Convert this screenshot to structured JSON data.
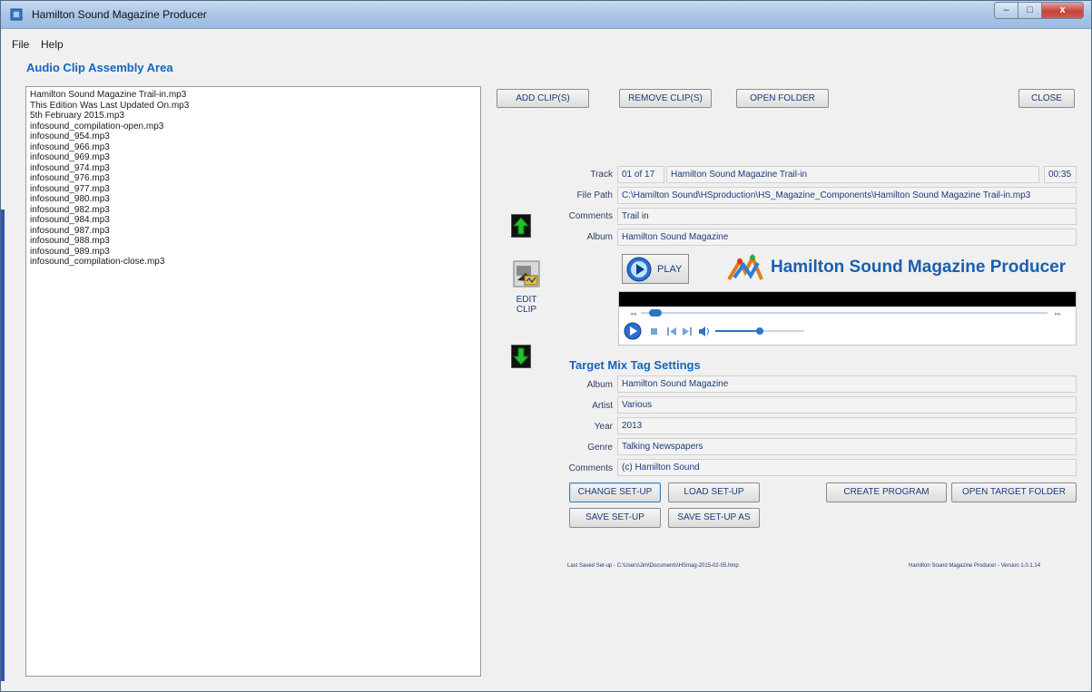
{
  "window": {
    "title": "Hamilton Sound Magazine Producer",
    "controls": [
      "–",
      "□",
      "x"
    ]
  },
  "menu": [
    "File",
    "Help"
  ],
  "assembly_area_title": "Audio Clip Assembly Area",
  "clips": [
    "Hamilton Sound Magazine Trail-in.mp3",
    "This Edition Was Last Updated On.mp3",
    "5th February 2015.mp3",
    "infosound_compilation-open.mp3",
    "infosound_954.mp3",
    "infosound_966.mp3",
    "infosound_969.mp3",
    "infosound_974.mp3",
    "infosound_976.mp3",
    "infosound_977.mp3",
    "infosound_980.mp3",
    "infosound_982.mp3",
    "infosound_984.mp3",
    "infosound_987.mp3",
    "infosound_988.mp3",
    "infosound_989.mp3",
    "infosound_compilation-close.mp3"
  ],
  "top_buttons": {
    "add": "ADD CLIP(S)",
    "remove": "REMOVE CLIP(S)",
    "open_folder": "OPEN FOLDER",
    "close": "CLOSE"
  },
  "edit_clip_label": "EDIT CLIP",
  "track_info": {
    "track_label": "Track",
    "track_number": "01 of 17",
    "track_name": "Hamilton Sound Magazine Trail-in",
    "duration": "00:35",
    "file_path_label": "File Path",
    "file_path": "C:\\Hamilton Sound\\HSproduction\\HS_Magazine_Components\\Hamilton Sound Magazine Trail-in.mp3",
    "comments_label": "Comments",
    "comments": "Trail in",
    "album_label": "Album",
    "album": "Hamilton Sound Magazine"
  },
  "play_label": "PLAY",
  "brand_title": "Hamilton Sound Magazine Producer",
  "player": {
    "seek_position": 0.02,
    "volume_level": 0.5
  },
  "target_mix": {
    "title": "Target Mix Tag Settings",
    "album_label": "Album",
    "album": "Hamilton Sound Magazine",
    "artist_label": "Artist",
    "artist": "Various",
    "year_label": "Year",
    "year": "2013",
    "genre_label": "Genre",
    "genre": "Talking Newspapers",
    "comments_label": "Comments",
    "comments": "(c) Hamilton Sound"
  },
  "setup_buttons": {
    "change": "CHANGE SET-UP",
    "load": "LOAD SET-UP",
    "save": "SAVE SET-UP",
    "save_as": "SAVE SET-UP AS",
    "create_program": "CREATE PROGRAM",
    "open_target_folder": "OPEN TARGET FOLDER"
  },
  "footer": {
    "last_saved": "Last Saved Set-up - C:\\Users\\Jim\\Documents\\HSmag-2015-02-05.hmp",
    "version": "Hamilton Sound Magazine Producer - Version 1.0.1.14"
  }
}
